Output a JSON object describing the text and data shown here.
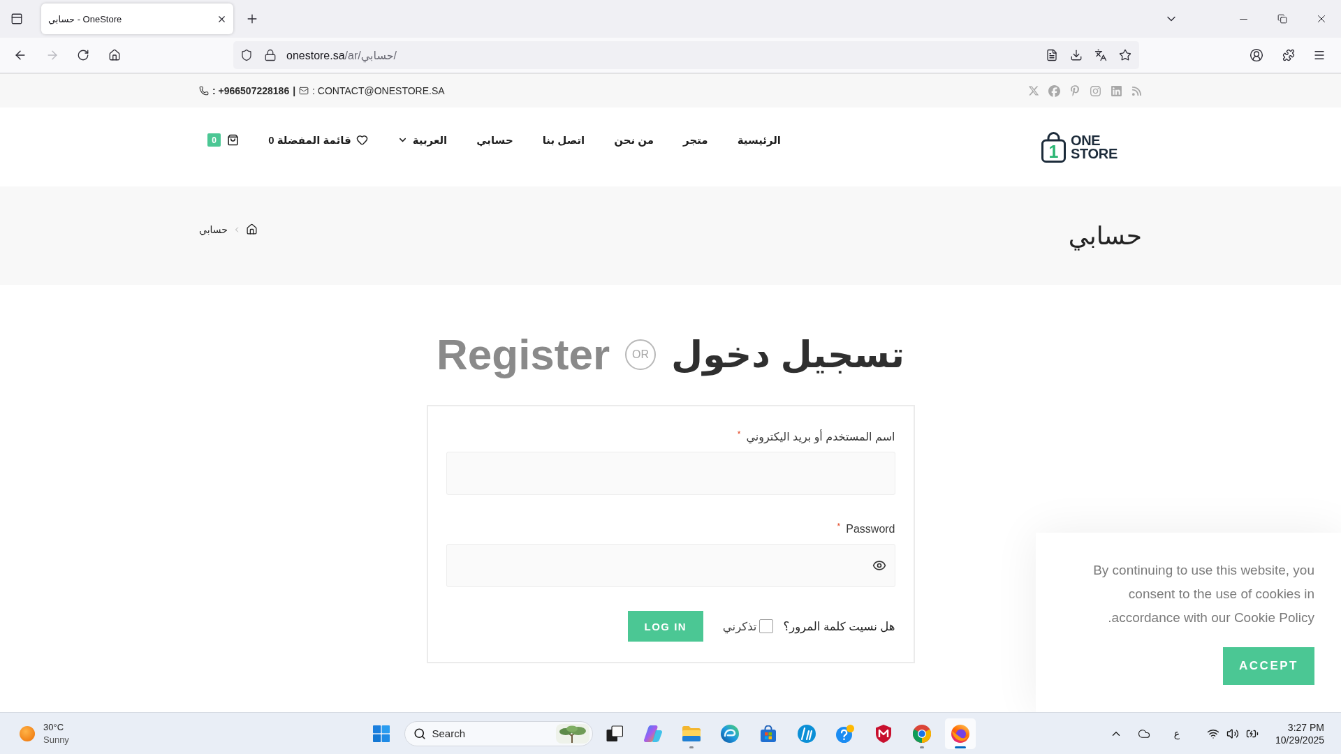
{
  "browser": {
    "tabs": [
      {
        "title": "حسابي - OneStore",
        "selected": true
      }
    ],
    "back_disabled": false,
    "forward_disabled": true,
    "address": {
      "host": "onestore.sa",
      "path": "/ar/حسابي/"
    }
  },
  "top_bar": {
    "phone": ": +966507228186",
    "separator": "|",
    "email": ": CONTACT@ONESTORE.SA"
  },
  "header": {
    "logo": {
      "mark": "1",
      "words": [
        "ONE",
        "STORE"
      ]
    },
    "menu": [
      {
        "label": "الرئيسية",
        "dropdown": false
      },
      {
        "label": "متجر",
        "dropdown": false
      },
      {
        "label": "من نحن",
        "dropdown": false
      },
      {
        "label": "اتصل بنا",
        "dropdown": false
      },
      {
        "label": "حسابي",
        "dropdown": false
      },
      {
        "label": "العربية",
        "dropdown": true
      }
    ],
    "wishlist": {
      "label": "قائمة المفضلة",
      "count": "0"
    },
    "cart": {
      "count": "0"
    }
  },
  "page_header": {
    "title": "حسابي",
    "breadcrumb": "حسابي"
  },
  "auth": {
    "tabs": [
      {
        "label": "تسجيل دخول",
        "selected": true
      },
      {
        "label": "Register",
        "selected": false
      }
    ],
    "or_label": "OR",
    "fields": [
      {
        "kind": "text",
        "label": "اسم المستخدم أو بريد اليكتروني",
        "required_mark": "*"
      },
      {
        "kind": "password",
        "label": "Password",
        "required_mark": "*"
      }
    ],
    "forgot_link": "هل نسيت كلمة المرور؟",
    "remember": {
      "label": "تذكرني",
      "checked": false
    },
    "submit": "LOG IN"
  },
  "cookie_notice": {
    "text": "By continuing to use this website, you consent to the use of cookies in accordance with our Cookie Policy.",
    "button": "ACCEPT"
  },
  "taskbar": {
    "weather": {
      "temperature": "30°C",
      "condition": "Sunny"
    },
    "search": {
      "placeholder": "Search"
    },
    "apps": [
      {
        "kind": "task-view",
        "running": false,
        "active": false
      },
      {
        "kind": "assistant",
        "running": false,
        "active": false
      },
      {
        "kind": "files",
        "running": true,
        "active": false
      },
      {
        "kind": "web",
        "running": false,
        "active": false
      },
      {
        "kind": "store",
        "running": false,
        "active": false
      },
      {
        "kind": "round-logo",
        "running": false,
        "active": false
      },
      {
        "kind": "help",
        "running": false,
        "active": false
      },
      {
        "kind": "shield",
        "running": false,
        "active": false
      },
      {
        "kind": "tricolor",
        "running": true,
        "active": false
      },
      {
        "kind": "fox",
        "running": true,
        "active": true
      }
    ],
    "language": "ع",
    "clock": {
      "time": "3:27 PM",
      "date": "10/29/2025"
    }
  }
}
